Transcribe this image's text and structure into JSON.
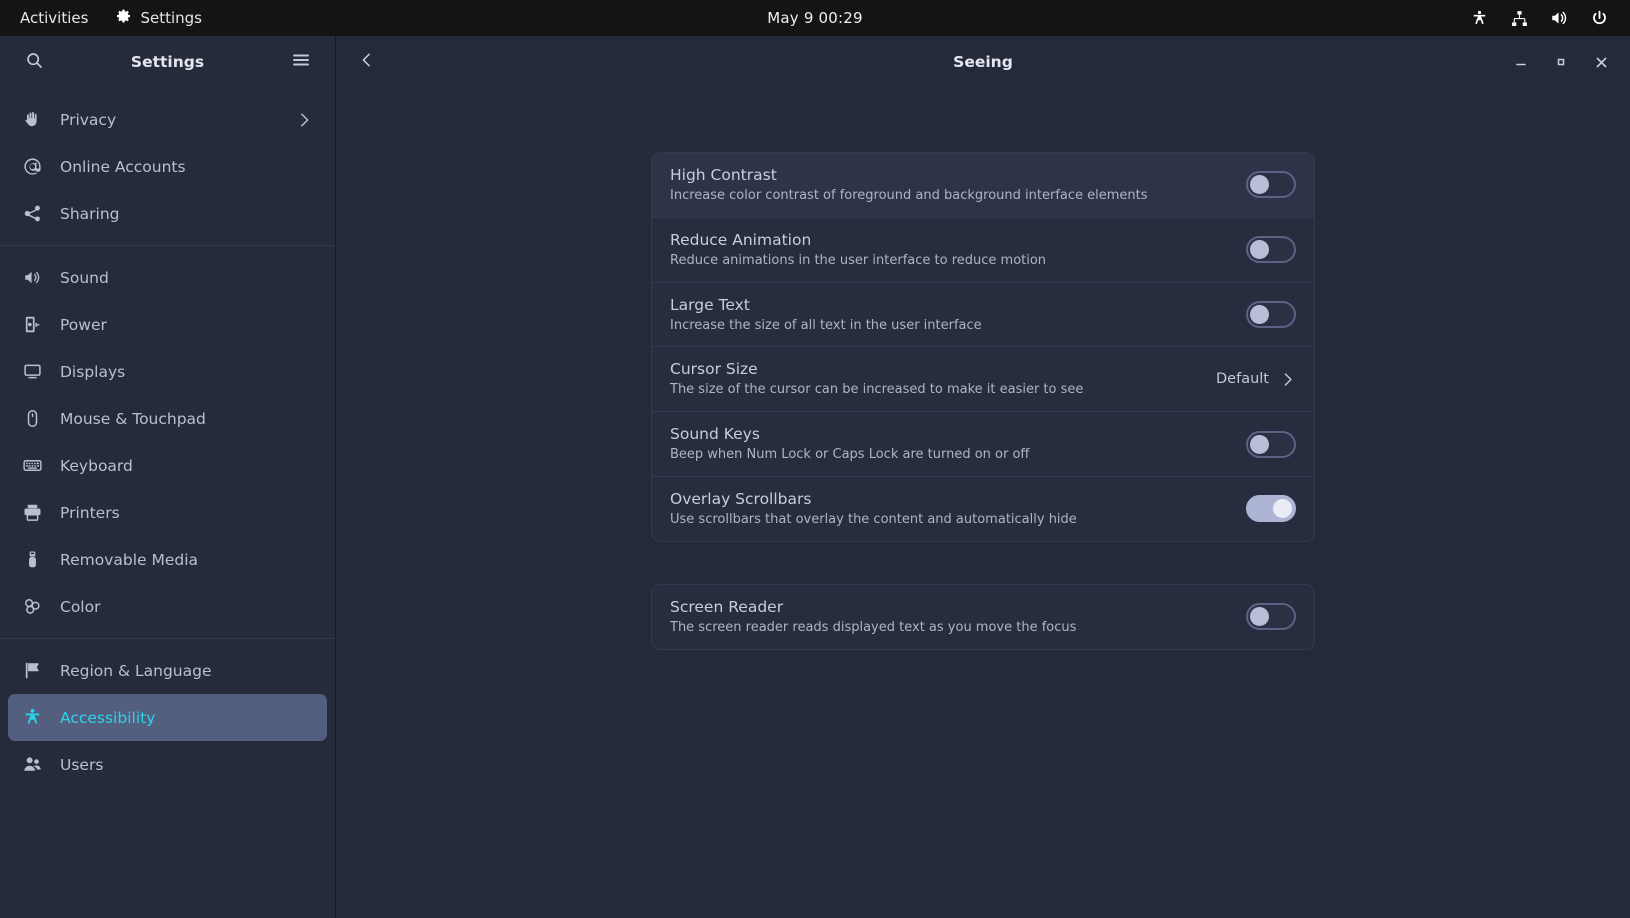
{
  "topbar": {
    "activities": "Activities",
    "app_name": "Settings",
    "app_icon": "gear-icon",
    "clock": "May 9  00:29",
    "indicators": [
      {
        "name": "accessibility-icon"
      },
      {
        "name": "network-icon"
      },
      {
        "name": "volume-icon"
      },
      {
        "name": "power-icon"
      }
    ]
  },
  "sidebar": {
    "title": "Settings",
    "search_icon": "search-icon",
    "menu_icon": "hamburger-menu-icon",
    "groups": [
      {
        "items": [
          {
            "label": "Privacy",
            "icon": "hand-icon",
            "chevron": true,
            "selected": false
          },
          {
            "label": "Online Accounts",
            "icon": "at-sign-icon",
            "chevron": false,
            "selected": false
          },
          {
            "label": "Sharing",
            "icon": "share-icon",
            "chevron": false,
            "selected": false
          }
        ]
      },
      {
        "items": [
          {
            "label": "Sound",
            "icon": "speaker-icon",
            "chevron": false,
            "selected": false
          },
          {
            "label": "Power",
            "icon": "power-plug-icon",
            "chevron": false,
            "selected": false
          },
          {
            "label": "Displays",
            "icon": "monitor-icon",
            "chevron": false,
            "selected": false
          },
          {
            "label": "Mouse & Touchpad",
            "icon": "mouse-icon",
            "chevron": false,
            "selected": false
          },
          {
            "label": "Keyboard",
            "icon": "keyboard-icon",
            "chevron": false,
            "selected": false
          },
          {
            "label": "Printers",
            "icon": "printer-icon",
            "chevron": false,
            "selected": false
          },
          {
            "label": "Removable Media",
            "icon": "usb-drive-icon",
            "chevron": false,
            "selected": false
          },
          {
            "label": "Color",
            "icon": "color-circles-icon",
            "chevron": false,
            "selected": false
          }
        ]
      },
      {
        "items": [
          {
            "label": "Region & Language",
            "icon": "flag-icon",
            "chevron": false,
            "selected": false
          },
          {
            "label": "Accessibility",
            "icon": "accessibility-person-icon",
            "chevron": false,
            "selected": true
          },
          {
            "label": "Users",
            "icon": "users-icon",
            "chevron": false,
            "selected": false
          }
        ]
      }
    ]
  },
  "header": {
    "back_icon": "chevron-left-icon",
    "title": "Seeing",
    "minimize_label": "–",
    "maximize_label": "▫",
    "close_label": "✕"
  },
  "main": {
    "cards": [
      {
        "rows": [
          {
            "title": "High Contrast",
            "desc": "Increase color contrast of foreground and background interface elements",
            "control": "switch",
            "state": "off",
            "highlight": true
          },
          {
            "title": "Reduce Animation",
            "desc": "Reduce animations in the user interface to reduce motion",
            "control": "switch",
            "state": "off",
            "highlight": false
          },
          {
            "title": "Large Text",
            "desc": "Increase the size of all text in the user interface",
            "control": "switch",
            "state": "off",
            "highlight": false
          },
          {
            "title": "Cursor Size",
            "desc": "The size of the cursor can be increased to make it easier to see",
            "control": "value",
            "value": "Default",
            "highlight": false
          },
          {
            "title": "Sound Keys",
            "desc": "Beep when Num Lock or Caps Lock are turned on or off",
            "control": "switch",
            "state": "off",
            "highlight": false
          },
          {
            "title": "Overlay Scrollbars",
            "desc": "Use scrollbars that overlay the content and automatically hide",
            "control": "switch",
            "state": "on",
            "highlight": false
          }
        ]
      },
      {
        "rows": [
          {
            "title": "Screen Reader",
            "desc": "The screen reader reads displayed text as you move the focus",
            "control": "switch",
            "state": "off",
            "highlight": false
          }
        ]
      }
    ]
  },
  "colors": {
    "topbar_bg": "#141414",
    "sidebar_bg": "#262b3c",
    "content_bg": "#252a3b",
    "card_bg": "#272c3e",
    "selection_bg": "#545f80",
    "accent_text": "#2ad4e8",
    "switch_on": "#aeb4d4"
  }
}
